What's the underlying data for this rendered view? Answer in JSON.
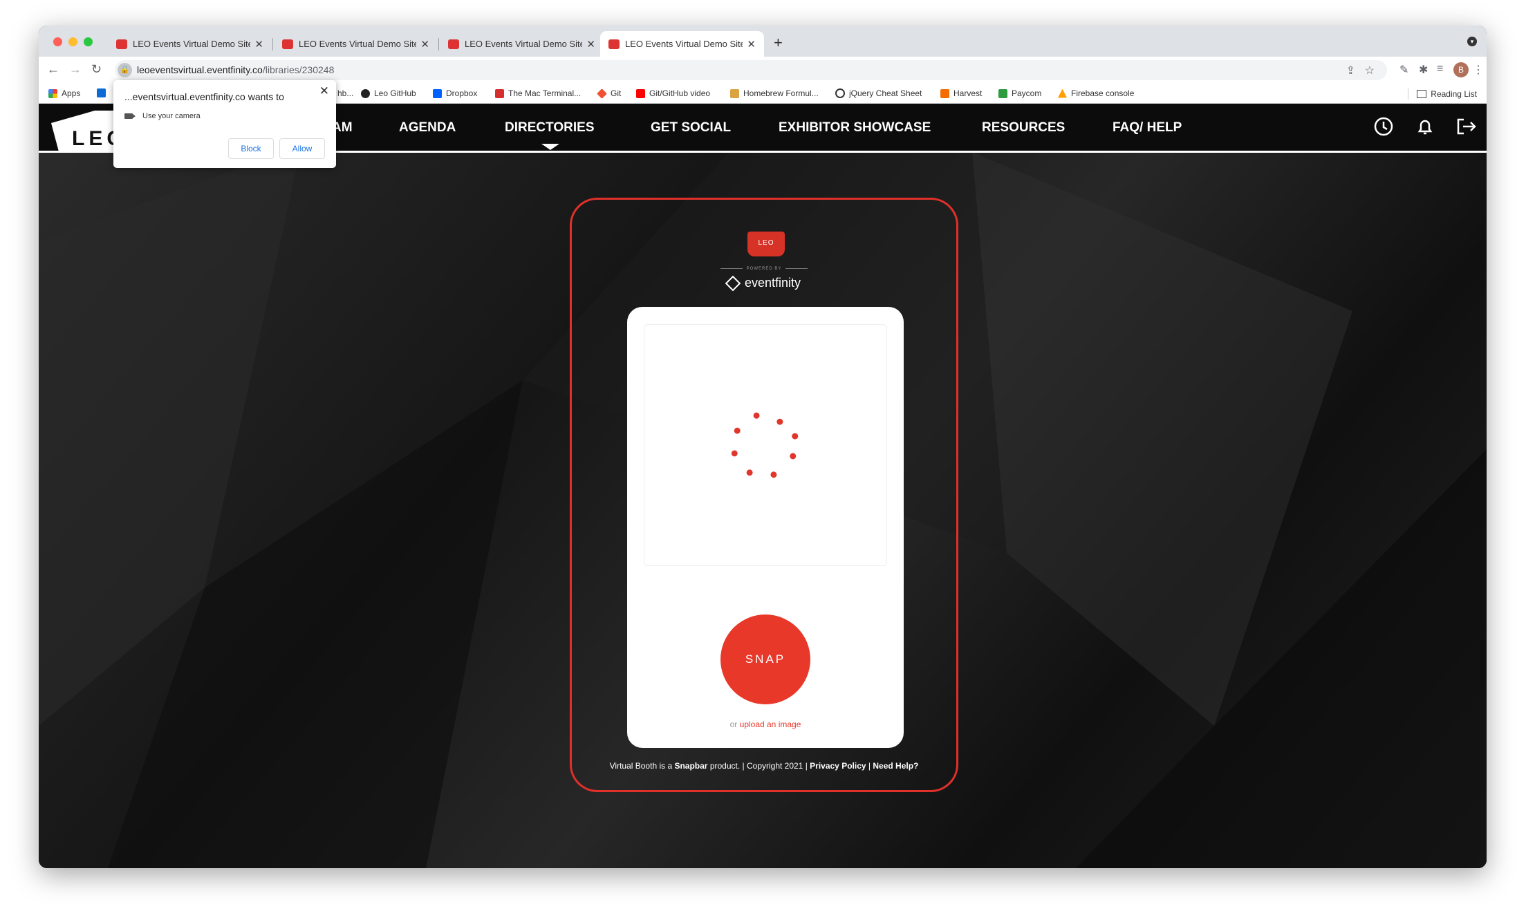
{
  "browser": {
    "tabs": [
      {
        "title": "LEO Events Virtual Demo Site -"
      },
      {
        "title": "LEO Events Virtual Demo Site -"
      },
      {
        "title": "LEO Events Virtual Demo Site -"
      },
      {
        "title": "LEO Events Virtual Demo Site -"
      }
    ],
    "active_tab_index": 3,
    "url_host": "leoeventsvirtual.eventfinity.co",
    "url_path": "/libraries/230248",
    "profile_initial": "B",
    "bookmarks": [
      {
        "label": "Apps",
        "icon": "apps-grid-icon"
      },
      {
        "label": "Leo GitHub",
        "icon": "github-icon"
      },
      {
        "label": "Dropbox",
        "icon": "dropbox-icon"
      },
      {
        "label": "The Mac Terminal...",
        "icon": "terminal-icon"
      },
      {
        "label": "Git",
        "icon": "git-icon"
      },
      {
        "label": "Git/GitHub video",
        "icon": "youtube-icon"
      },
      {
        "label": "Homebrew Formul...",
        "icon": "homebrew-icon"
      },
      {
        "label": "jQuery Cheat Sheet",
        "icon": "jquery-icon"
      },
      {
        "label": "Harvest",
        "icon": "harvest-icon"
      },
      {
        "label": "Paycom",
        "icon": "paycom-icon"
      },
      {
        "label": "Firebase console",
        "icon": "firebase-icon"
      }
    ],
    "reading_list": "Reading List"
  },
  "permission_popup": {
    "title": "...eventsvirtual.eventfinity.co wants to",
    "permission": "Use your camera",
    "block_label": "Block",
    "allow_label": "Allow",
    "partial_bookmark": "hb..."
  },
  "site_nav": {
    "logo_text": "LEO",
    "partial_item": "AM",
    "items": [
      "AGENDA",
      "DIRECTORIES",
      "GET SOCIAL",
      "EXHIBITOR SHOWCASE",
      "RESOURCES",
      "FAQ/ HELP"
    ],
    "active_item": "DIRECTORIES"
  },
  "booth": {
    "logo_text": "LEO",
    "powered_by": "POWERED BY",
    "brand": "eventfinity",
    "snap_label": "SNAP",
    "upload_prefix": "or",
    "upload_link": "upload an image",
    "footer": {
      "pre": "Virtual Booth is a",
      "product": "Snapbar",
      "mid": "product. | Copyright 2021 |",
      "privacy": "Privacy Policy",
      "sep": "|",
      "help": "Need Help?"
    }
  },
  "colors": {
    "accent": "#e8382a",
    "nav_bg": "#0c0c0c",
    "tabstrip": "#dee1e6"
  }
}
